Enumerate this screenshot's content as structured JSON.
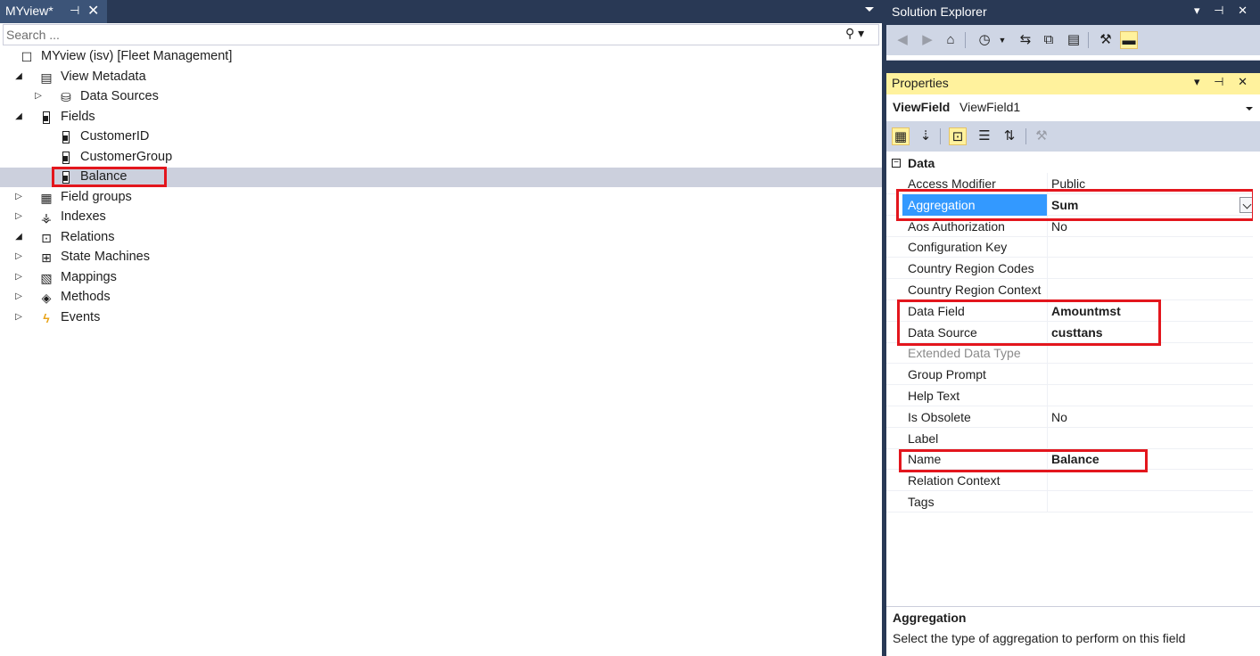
{
  "document": {
    "tab_title": "MYview*",
    "pin_glyph": "⊣",
    "close_glyph": "✕",
    "search": {
      "placeholder": "Search ...",
      "icon": "search-icon",
      "icon_glyph": "⚲ ▾"
    }
  },
  "tree": [
    {
      "label": "MYview (isv) [Fleet Management]",
      "icon": "view-icon",
      "expander": ""
    },
    {
      "label": "View Metadata",
      "icon": "metadata-icon",
      "expander": "◢"
    },
    {
      "label": "Data Sources",
      "icon": "database-icon",
      "expander": "▷"
    },
    {
      "label": "Fields",
      "icon": "field-icon",
      "expander": "◢"
    },
    {
      "label": "CustomerID",
      "icon": "field-icon",
      "expander": ""
    },
    {
      "label": "CustomerGroup",
      "icon": "field-icon",
      "expander": ""
    },
    {
      "label": "Balance",
      "icon": "field-icon",
      "expander": "",
      "selected": true
    },
    {
      "label": "Field groups",
      "icon": "field-groups-icon",
      "expander": "▷"
    },
    {
      "label": "Indexes",
      "icon": "indexes-icon",
      "expander": "▷"
    },
    {
      "label": "Relations",
      "icon": "relations-icon",
      "expander": "◢"
    },
    {
      "label": "State Machines",
      "icon": "state-machines-icon",
      "expander": "▷"
    },
    {
      "label": "Mappings",
      "icon": "mappings-icon",
      "expander": "▷"
    },
    {
      "label": "Methods",
      "icon": "methods-icon",
      "expander": "▷"
    },
    {
      "label": "Events",
      "icon": "lightning-icon",
      "expander": "▷"
    }
  ],
  "solution_explorer": {
    "title": "Solution Explorer",
    "controls": "▾ ⊣ ✕"
  },
  "properties": {
    "title": "Properties",
    "controls": "▾ ⊣ ✕",
    "object_kind": "ViewField",
    "object_name": "ViewField1",
    "category": "Data",
    "category_toggle": "−",
    "rows": [
      {
        "name": "Access Modifier",
        "value": "Public"
      },
      {
        "name": "Aggregation",
        "value": "Sum",
        "selected": true
      },
      {
        "name": "Aos Authorization",
        "value": "No"
      },
      {
        "name": "Configuration Key",
        "value": ""
      },
      {
        "name": "Country Region Codes",
        "value": ""
      },
      {
        "name": "Country Region Context",
        "value": ""
      },
      {
        "name": "Data Field",
        "value": "Amountmst"
      },
      {
        "name": "Data Source",
        "value": "custtans"
      },
      {
        "name": "Extended Data Type",
        "value": "",
        "disabled": true
      },
      {
        "name": "Group Prompt",
        "value": ""
      },
      {
        "name": "Help Text",
        "value": ""
      },
      {
        "name": "Is Obsolete",
        "value": "No"
      },
      {
        "name": "Label",
        "value": ""
      },
      {
        "name": "Name",
        "value": "Balance"
      },
      {
        "name": "Relation Context",
        "value": ""
      },
      {
        "name": "Tags",
        "value": ""
      }
    ],
    "description": {
      "title": "Aggregation",
      "text": "Select the type of aggregation to perform on this field"
    }
  },
  "colors": {
    "frame": "#293955",
    "selection": "#3399ff",
    "tree_selection": "#ccd0dd",
    "highlight_box": "#e3161d",
    "properties_header": "#fff29d"
  }
}
